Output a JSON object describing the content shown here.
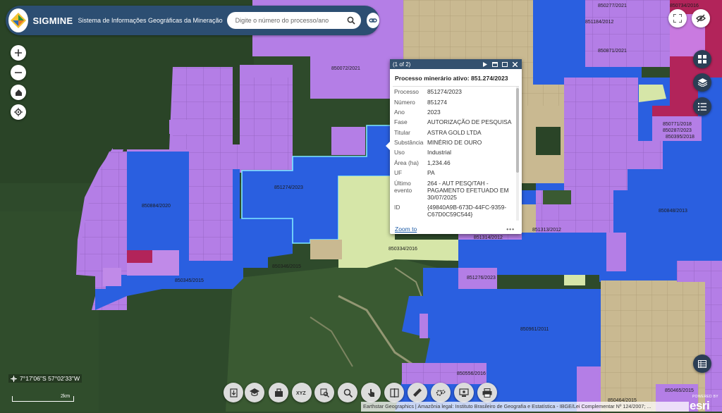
{
  "header": {
    "brand": "SIGMINE",
    "subtitle": "Sistema de Informações Geográficas da Mineração",
    "search_placeholder": "Digite o número do processo/ano"
  },
  "colors": {
    "header_bg": "#2c4e72",
    "popup_header": "#34516f",
    "parcel_blue": "#2a5fe0",
    "parcel_purple": "#b47ee6",
    "parcel_tan": "#c9b991",
    "parcel_yellowgreen": "#d6e6a8",
    "parcel_magenta": "#b2245a",
    "selection_outline": "#7fe9ff"
  },
  "map": {
    "parcel_labels": [
      "850072/2021",
      "851274/2023",
      "850884/2020",
      "850345/2015",
      "850346/2015",
      "850334/2016",
      "851314/2012",
      "851276/2023",
      "851313/2012",
      "850848/2013",
      "850961/2011",
      "850556/2016",
      "850464/2015",
      "850465/2015",
      "850277/2021",
      "851184/2012",
      "850871/2021",
      "850734/2016",
      "850771/2018",
      "850287/2023",
      "850395/2018"
    ]
  },
  "popup": {
    "count": "(1 of 2)",
    "title": "Processo minerário ativo: 851.274/2023",
    "fields": [
      {
        "k": "Processo",
        "v": "851274/2023"
      },
      {
        "k": "Número",
        "v": "851274"
      },
      {
        "k": "Ano",
        "v": "2023"
      },
      {
        "k": "Fase",
        "v": "AUTORIZAÇÃO DE PESQUISA"
      },
      {
        "k": "Titular",
        "v": "ASTRA GOLD LTDA"
      },
      {
        "k": "Substância",
        "v": "MINÉRIO DE OURO"
      },
      {
        "k": "Uso",
        "v": "Industrial"
      },
      {
        "k": "Área (ha)",
        "v": "1,234.46"
      },
      {
        "k": "UF",
        "v": "PA"
      },
      {
        "k": "Último evento",
        "v": "264 - AUT PESQ/TAH - PAGAMENTO EFETUADO EM 30/07/2025"
      },
      {
        "k": "ID",
        "v": "{49840A9B-673D-44FC-9359-C67D0C59C544}"
      }
    ],
    "zoom_to": "Zoom to"
  },
  "coords": "7°17'06\"S 57°02'33\"W",
  "scale": "2km",
  "attribution": "Earthstar Geographics | Amazônia legal: Instituto Brasileiro de Geografia e Estatística - IBGE/Lei Complementar Nº 124/2007; ...",
  "esri": {
    "powered_by": "POWERED BY",
    "mark": "esri"
  },
  "toolbar_icons": [
    "import-icon",
    "graduation-cap-icon",
    "layers-overlay-icon",
    "xyz-coordinates-icon",
    "search-map-icon",
    "search-icon",
    "touch-select-icon",
    "compare-icon",
    "measure-ruler-icon",
    "gear-print-icon",
    "screenshot-icon",
    "print-icon"
  ]
}
